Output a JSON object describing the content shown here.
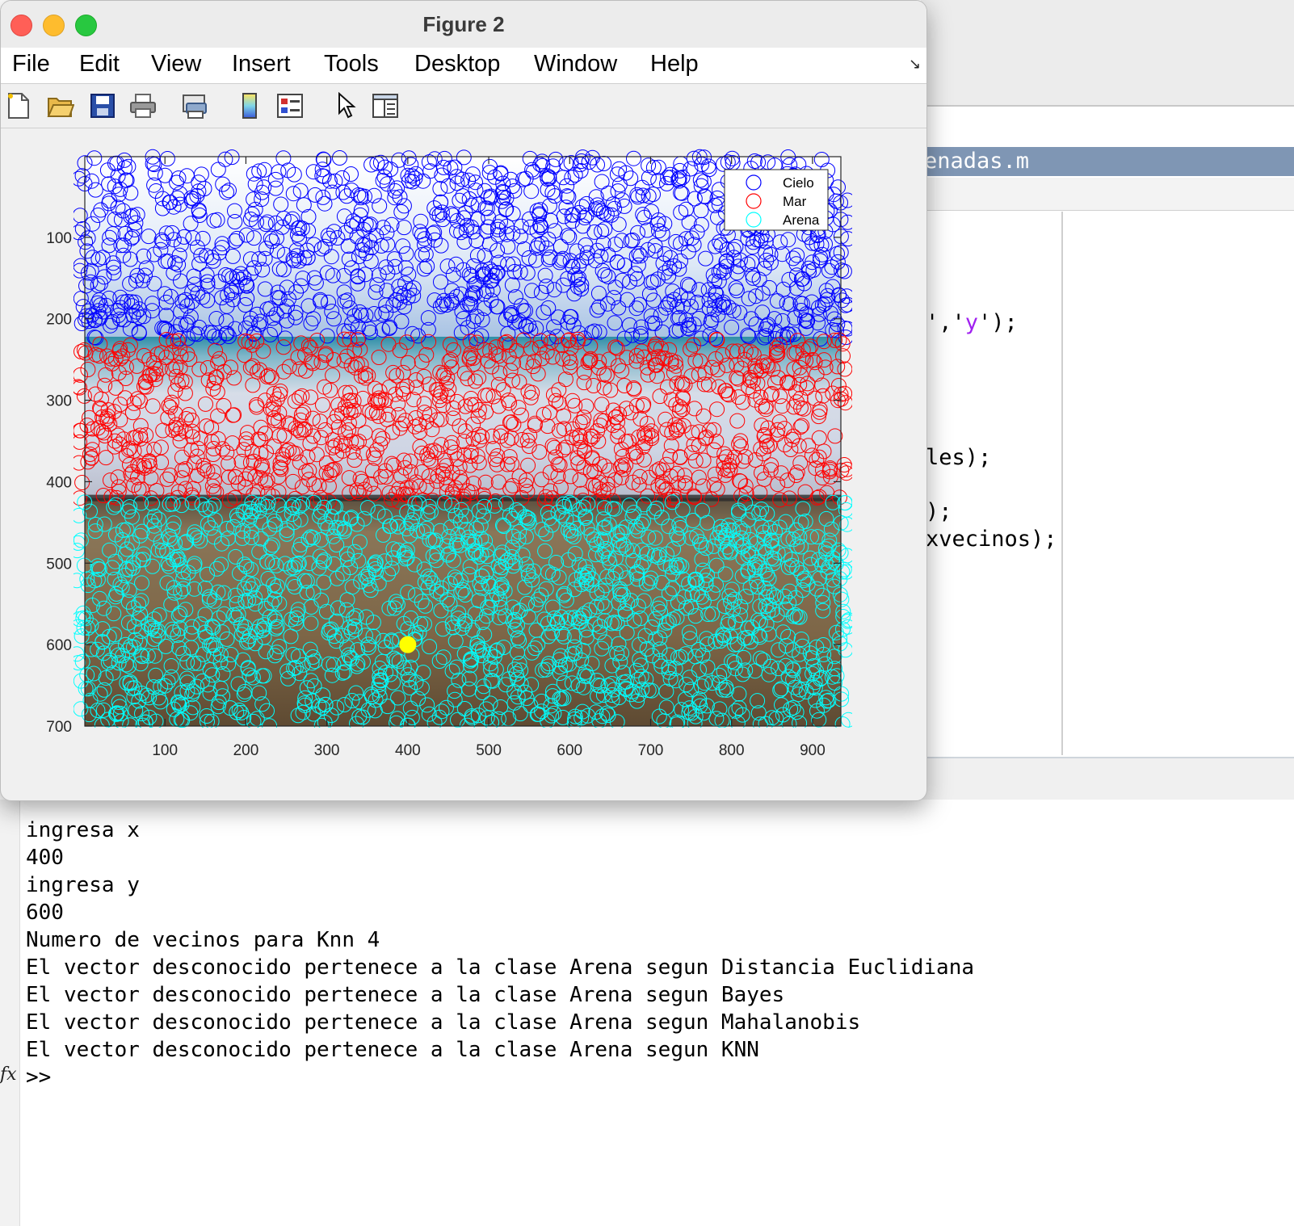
{
  "figure": {
    "title": "Figure 2",
    "menu": [
      "File",
      "Edit",
      "View",
      "Insert",
      "Tools",
      "Desktop",
      "Window",
      "Help"
    ],
    "toolbar": [
      "new-figure-icon",
      "open-file-icon",
      "save-icon",
      "print-icon",
      "print-preview-icon",
      "colorbar-icon",
      "legend-icon",
      "select-pointer-icon",
      "property-inspector-icon"
    ]
  },
  "editor": {
    "tab_title_visible": "enadas.m",
    "code_fragments": [
      {
        "pre": "','",
        "str": "y",
        "post": "');"
      },
      {
        "pre": "les);",
        "str": "",
        "post": ""
      },
      {
        "pre": ");",
        "str": "",
        "post": ""
      },
      {
        "pre": "xvecinos);",
        "str": "",
        "post": ""
      }
    ]
  },
  "command_window": {
    "lines": [
      "ingresa x",
      "400",
      "ingresa y",
      "600",
      "Numero de vecinos para Knn 4",
      "El vector desconocido pertenece a la clase Arena segun Distancia Euclidiana",
      "El vector desconocido pertenece a la clase Arena segun Bayes",
      "El vector desconocido pertenece a la clase Arena segun Mahalanobis",
      "El vector desconocido pertenece a la clase Arena segun KNN"
    ],
    "prompt": ">>"
  },
  "chart_data": {
    "type": "scatter",
    "background": "beach photograph (sky, sea, sand)",
    "x_ticks": [
      100,
      200,
      300,
      400,
      500,
      600,
      700,
      800,
      900
    ],
    "y_ticks": [
      100,
      200,
      300,
      400,
      500,
      600,
      700
    ],
    "xlim": [
      1,
      935
    ],
    "ylim": [
      1,
      700
    ],
    "y_reversed": true,
    "legend_position": "top-right",
    "series": [
      {
        "name": "Cielo",
        "color": "#0000ff",
        "marker": "circle-open",
        "y_range": [
          1,
          225
        ],
        "count_approx": 1200
      },
      {
        "name": "Mar",
        "color": "#ff0000",
        "marker": "circle-open",
        "y_range": [
          225,
          425
        ],
        "count_approx": 1100
      },
      {
        "name": "Arena",
        "color": "#00ffff",
        "marker": "circle-open",
        "y_range": [
          425,
          700
        ],
        "count_approx": 1500
      }
    ],
    "query_point": {
      "x": 400,
      "y": 600,
      "color": "#ffff00",
      "marker": "filled-circle"
    }
  }
}
